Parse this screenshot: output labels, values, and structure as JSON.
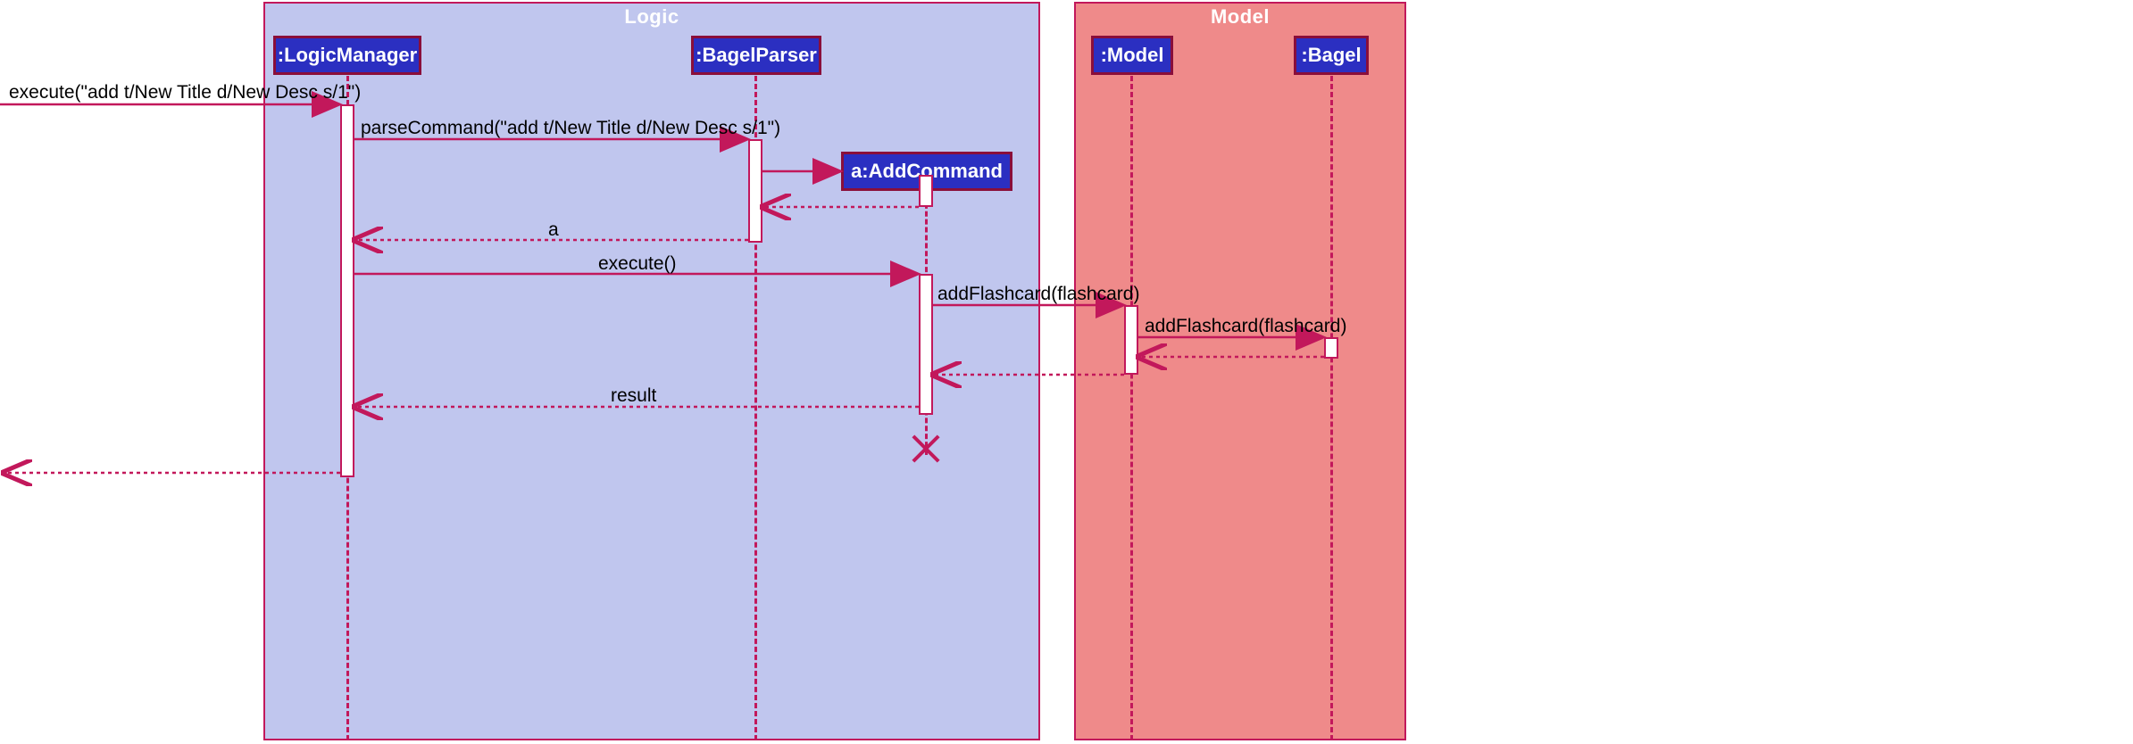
{
  "frames": {
    "logic": {
      "label": "Logic"
    },
    "model": {
      "label": "Model"
    }
  },
  "participants": {
    "logicManager": ":LogicManager",
    "bagelParser": ":BagelParser",
    "addCommand": "a:AddCommand",
    "model": ":Model",
    "bagel": ":Bagel"
  },
  "messages": {
    "m1": "execute(\"add t/New Title d/New Desc s/1\")",
    "m2": "parseCommand(\"add t/New Title d/New Desc s/1\")",
    "m3": "a",
    "m4": "execute()",
    "m5": "addFlashcard(flashcard)",
    "m6": "addFlashcard(flashcard)",
    "m7": "result"
  }
}
